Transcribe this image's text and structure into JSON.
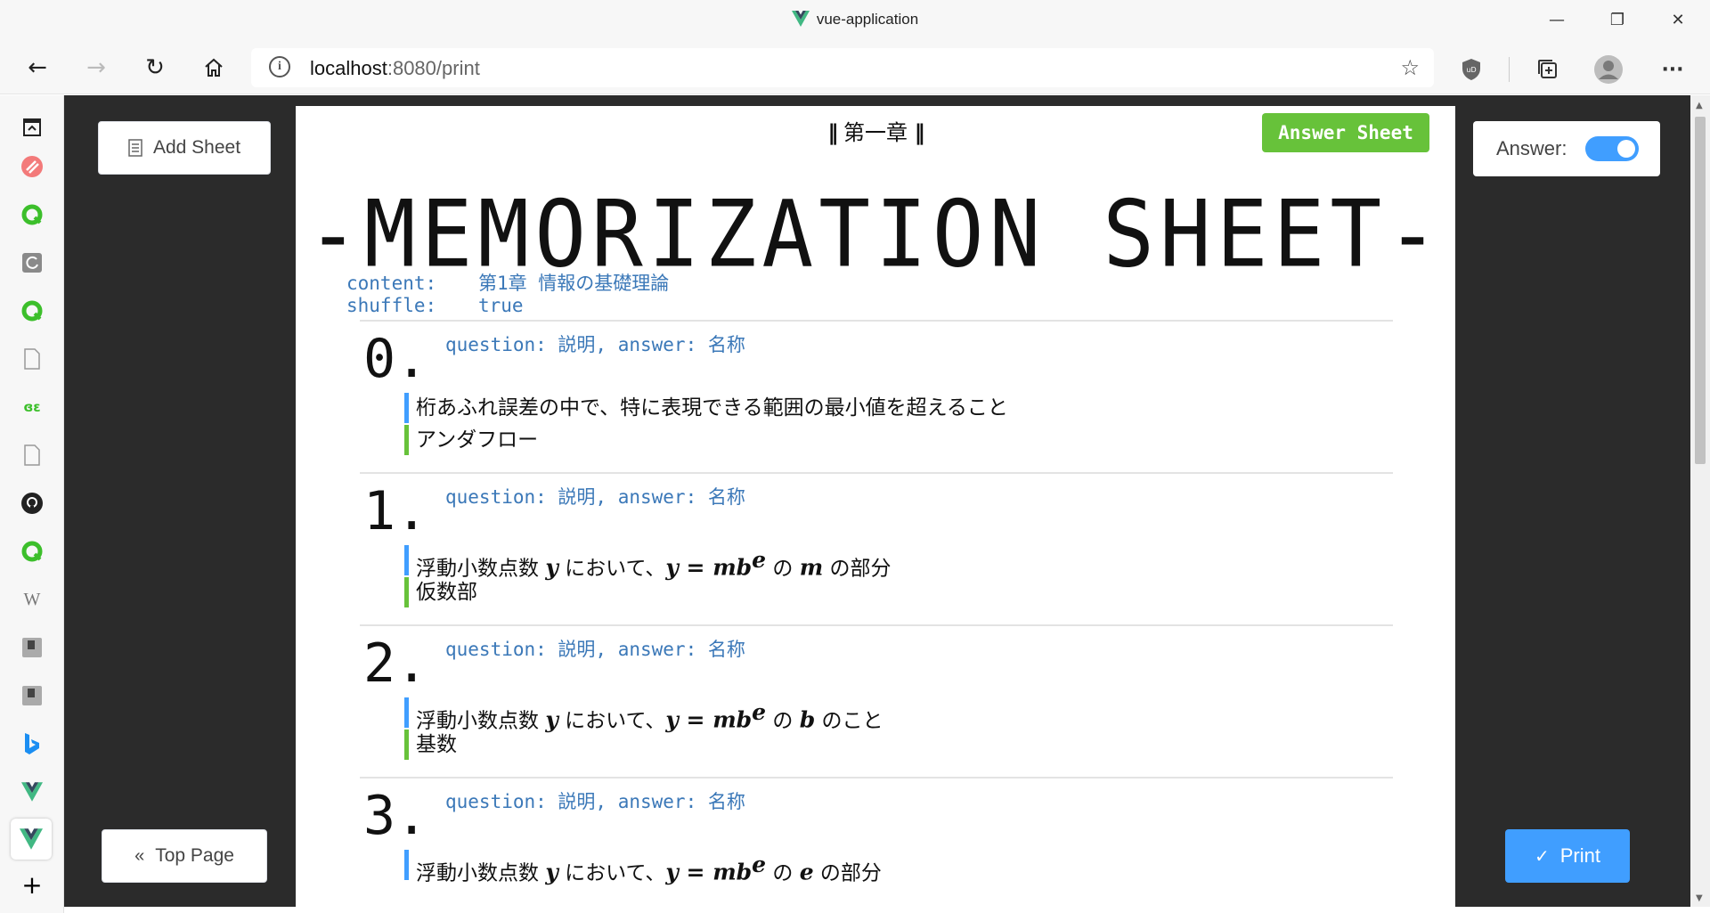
{
  "window": {
    "title": "vue-application"
  },
  "browser": {
    "url_host": "localhost",
    "url_path": ":8080/print"
  },
  "toolbar": {
    "add_sheet": "Add Sheet",
    "top_page": "Top Page",
    "answer_label": "Answer:",
    "answer_enabled": true,
    "print": "Print"
  },
  "sheet": {
    "chapter": "第一章",
    "answer_sheet_tag": "Answer Sheet",
    "title": "-MEMORIZATION SHEET-",
    "content_key": "content:",
    "content_value": "第1章 情報の基礎理論",
    "shuffle_key": "shuffle:",
    "shuffle_value": "true",
    "questions": [
      {
        "num": "0.",
        "type": "question: 説明, answer: 名称",
        "question": "桁あふれ誤差の中で、特に表現できる範囲の最小値を超えること",
        "answer": "アンダフロー"
      },
      {
        "num": "1.",
        "type": "question: 説明, answer: 名称",
        "q_pre": "浮動小数点数 ",
        "q_var": "y",
        "q_mid": " において、",
        "q_formula": "y = mb",
        "q_sup": "e",
        "q_mid2": " の ",
        "q_var2": "m",
        "q_post": " の部分",
        "answer": "仮数部"
      },
      {
        "num": "2.",
        "type": "question: 説明, answer: 名称",
        "q_pre": "浮動小数点数 ",
        "q_var": "y",
        "q_mid": " において、",
        "q_formula": "y = mb",
        "q_sup": "e",
        "q_mid2": " の ",
        "q_var2": "b",
        "q_post": " のこと",
        "answer": "基数"
      },
      {
        "num": "3.",
        "type": "question: 説明, answer: 名称",
        "q_pre": "浮動小数点数 ",
        "q_var": "y",
        "q_mid": " において、",
        "q_formula": "y = mb",
        "q_sup": "e",
        "q_mid2": " の ",
        "q_var2": "e",
        "q_post": " の部分"
      }
    ]
  },
  "sidebar_icons": [
    "collections-icon",
    "reddit-like-icon",
    "green-q-icon",
    "refresh-doc-icon",
    "green-q-icon",
    "doc-icon",
    "gfg-icon",
    "doc-icon",
    "github-icon",
    "green-q-icon",
    "wikipedia-icon",
    "app-icon",
    "app-icon",
    "bing-icon",
    "vue-icon",
    "vue-icon",
    "add-icon"
  ],
  "colors": {
    "primary": "#409eff",
    "success": "#67c23a",
    "meta_text": "#3b78b8",
    "background": "#2b2b2b"
  }
}
